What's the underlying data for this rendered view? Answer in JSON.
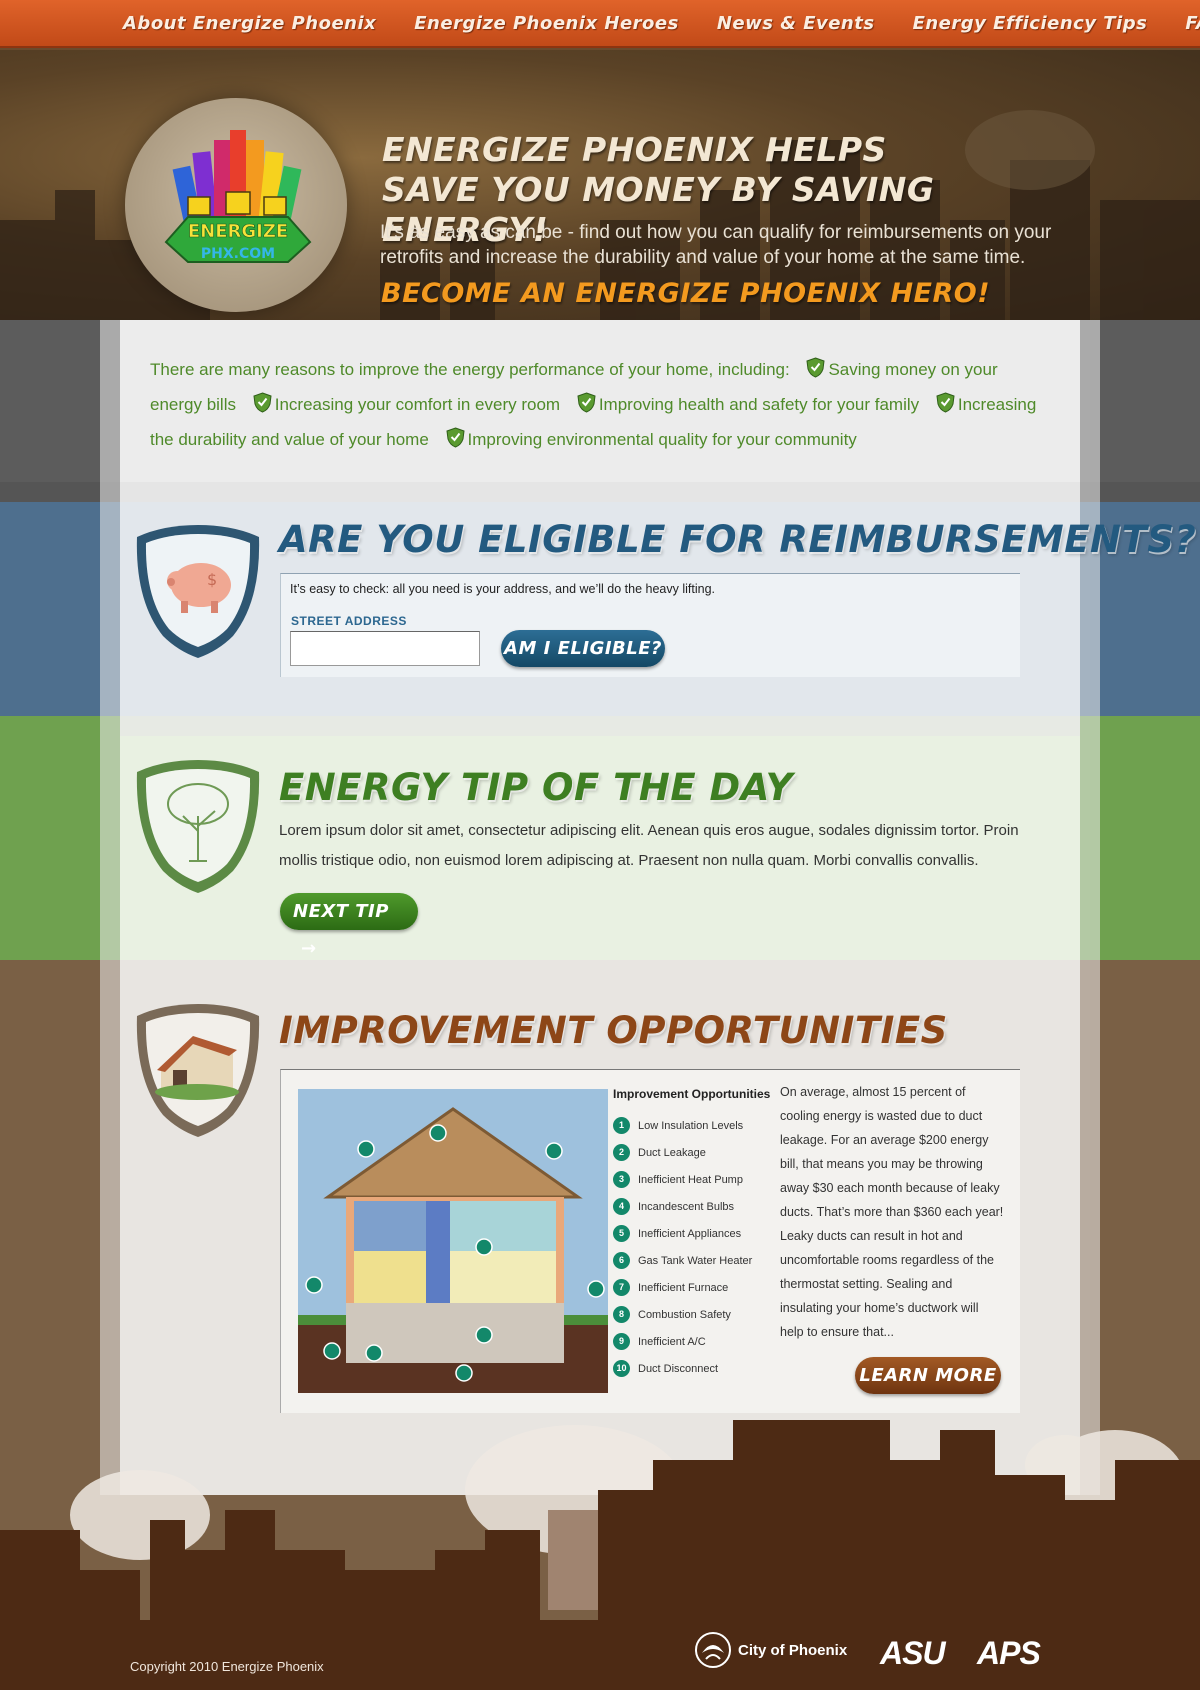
{
  "nav": {
    "items": [
      "About Energize Phoenix",
      "Energize Phoenix Heroes",
      "News & Events",
      "Energy Efficiency Tips",
      "FAQs"
    ]
  },
  "hero": {
    "logo_word": "ENERGIZE",
    "logo_url": "PHX.COM",
    "heading_line1": "Energize Phoenix helps",
    "heading_line2": "save you money by saving energy!",
    "subtext": "It’s as easy as can be - find out how you can qualify for reimbursements on your retrofits and increase the durability and value of your home at the same time.",
    "cta": "Become an Energize Phoenix Hero!"
  },
  "reasons": {
    "intro": "There are many reasons to improve the energy performance of your home, including:",
    "items": [
      "Saving money on your energy bills",
      "Increasing your comfort in every room",
      "Improving health and safety for your family",
      "Increasing the durability and value of your home",
      "Improving environmental quality for your community"
    ]
  },
  "eligibility": {
    "title": "Are You Eligible for Reimbursements?",
    "intro": "It’s easy to check: all you need is your address, and we’ll do the heavy lifting.",
    "field_label": "STREET ADDRESS",
    "field_value": "",
    "button": "Am I Eligible?"
  },
  "tip": {
    "title": "Energy Tip of the Day",
    "text": "Lorem ipsum dolor sit amet, consectetur adipiscing elit. Aenean quis eros augue, sodales dignissim tortor. Proin mollis tristique odio, non euismod lorem adipiscing at. Praesent non nulla quam. Morbi convallis convallis.",
    "button": "Next Tip"
  },
  "improvement": {
    "title": "Improvement Opportunities",
    "legend_title": "Improvement Opportunities",
    "legend": [
      {
        "num": "1",
        "label": "Low Insulation Levels"
      },
      {
        "num": "2",
        "label": "Duct Leakage"
      },
      {
        "num": "3",
        "label": "Inefficient Heat Pump"
      },
      {
        "num": "4",
        "label": "Incandescent Bulbs"
      },
      {
        "num": "5",
        "label": "Inefficient Appliances"
      },
      {
        "num": "6",
        "label": "Gas Tank Water Heater"
      },
      {
        "num": "7",
        "label": "Inefficient Furnace"
      },
      {
        "num": "8",
        "label": "Combustion Safety"
      },
      {
        "num": "9",
        "label": "Inefficient A/C"
      },
      {
        "num": "10",
        "label": "Duct Disconnect"
      }
    ],
    "text": "On average, almost 15 percent of cooling energy is wasted due to duct leakage. For an average $200 energy bill, that means you may be throwing away $30 each month because of leaky ducts. That’s more than $360 each year!  Leaky ducts can result in hot and uncomfortable rooms regardless of the thermostat setting. Sealing and insulating your home’s ductwork will help to ensure that...",
    "button": "Learn More"
  },
  "footer": {
    "copyright": "Copyright 2010 Energize Phoenix",
    "partners": [
      "City of Phoenix",
      "ASU",
      "APS"
    ]
  },
  "colors": {
    "nav": "#d2561f",
    "reasons_green": "#4f8a2a",
    "eligibility_blue": "#235a80",
    "tip_green": "#3e7f22",
    "improvement_brown": "#8d4617",
    "hero_cta_orange": "#f39a1f"
  },
  "icons": [
    "shield-check-icon",
    "piggy-bank-icon",
    "tree-icon",
    "house-icon",
    "arrow-right-icon",
    "phoenix-bird-icon"
  ]
}
